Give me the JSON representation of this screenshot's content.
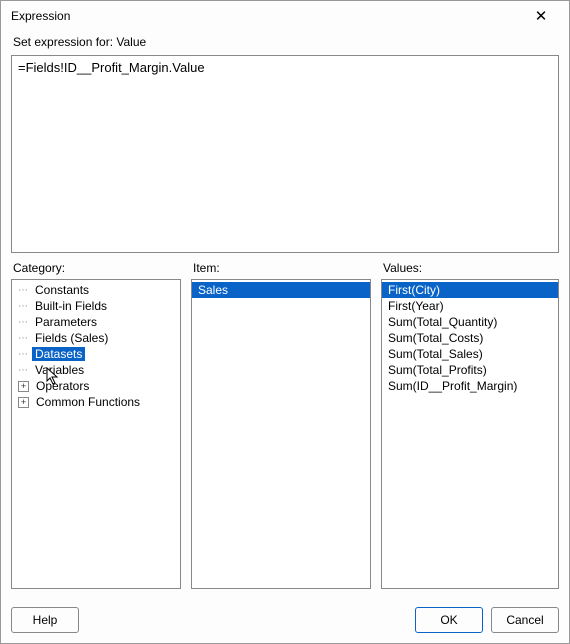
{
  "window": {
    "title": "Expression",
    "close_label": "✕"
  },
  "header": {
    "set_expression_label": "Set expression for: Value"
  },
  "expression": {
    "value": "=Fields!ID__Profit_Margin.Value"
  },
  "labels": {
    "category": "Category:",
    "item": "Item:",
    "values": "Values:"
  },
  "category_tree": [
    {
      "label": "Constants",
      "expandable": false,
      "selected": false
    },
    {
      "label": "Built-in Fields",
      "expandable": false,
      "selected": false
    },
    {
      "label": "Parameters",
      "expandable": false,
      "selected": false
    },
    {
      "label": "Fields (Sales)",
      "expandable": false,
      "selected": false
    },
    {
      "label": "Datasets",
      "expandable": false,
      "selected": true
    },
    {
      "label": "Variables",
      "expandable": false,
      "selected": false
    },
    {
      "label": "Operators",
      "expandable": true,
      "selected": false
    },
    {
      "label": "Common Functions",
      "expandable": true,
      "selected": false
    }
  ],
  "items": [
    {
      "label": "Sales",
      "selected": true
    }
  ],
  "values": [
    {
      "label": "First(City)",
      "selected": true
    },
    {
      "label": "First(Year)",
      "selected": false
    },
    {
      "label": "Sum(Total_Quantity)",
      "selected": false
    },
    {
      "label": "Sum(Total_Costs)",
      "selected": false
    },
    {
      "label": "Sum(Total_Sales)",
      "selected": false
    },
    {
      "label": "Sum(Total_Profits)",
      "selected": false
    },
    {
      "label": "Sum(ID__Profit_Margin)",
      "selected": false
    }
  ],
  "buttons": {
    "help": "Help",
    "ok": "OK",
    "cancel": "Cancel"
  }
}
